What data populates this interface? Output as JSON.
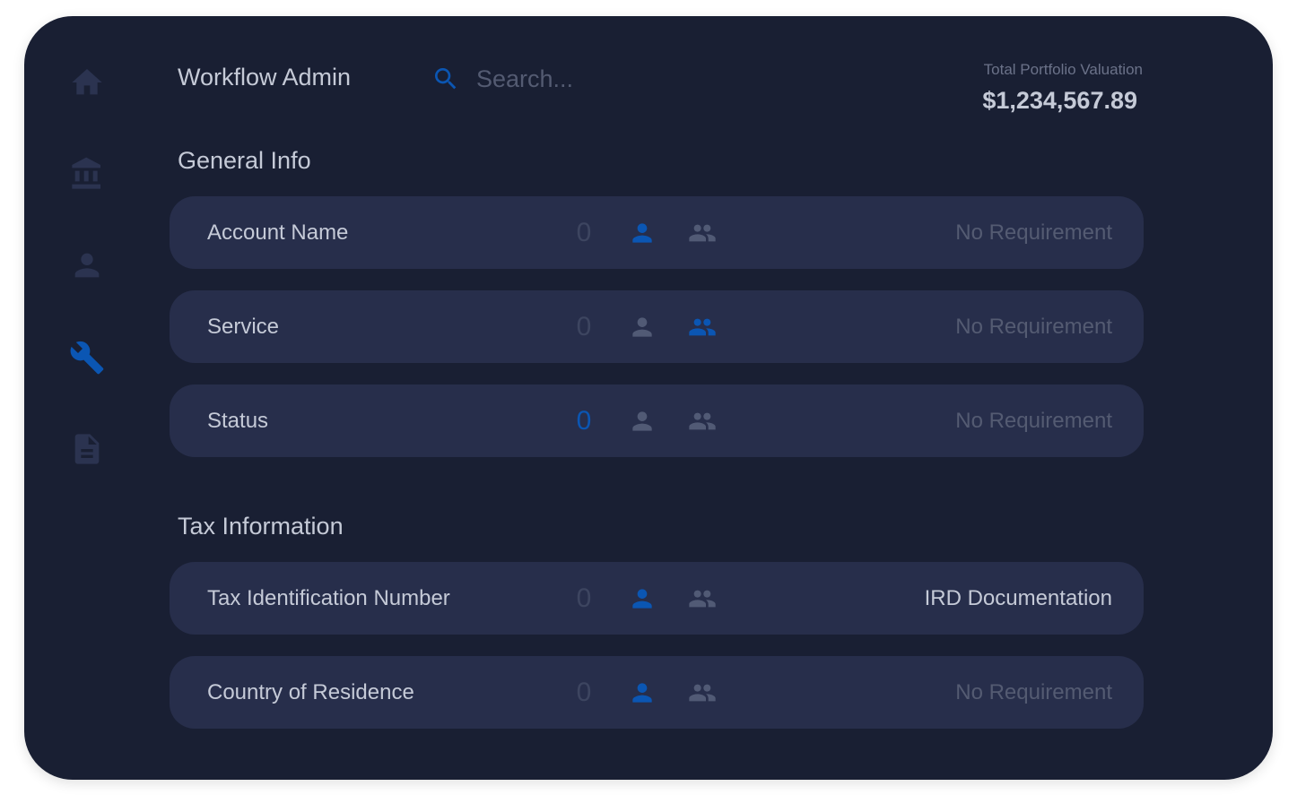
{
  "app": {
    "title": "Workflow Admin"
  },
  "search": {
    "placeholder": "Search..."
  },
  "portfolio": {
    "label": "Total Portfolio Valuation",
    "value": "$1,234,567.89"
  },
  "sidebar": {
    "items": [
      {
        "icon": "home-icon",
        "active": false
      },
      {
        "icon": "bank-icon",
        "active": false
      },
      {
        "icon": "person-icon",
        "active": false
      },
      {
        "icon": "wrench-icon",
        "active": true
      },
      {
        "icon": "document-icon",
        "active": false
      }
    ]
  },
  "sections": [
    {
      "title": "General Info",
      "rows": [
        {
          "label": "Account Name",
          "count": "0",
          "count_active": false,
          "individual_active": true,
          "group_active": false,
          "requirement": "No Requirement"
        },
        {
          "label": "Service",
          "count": "0",
          "count_active": false,
          "individual_active": false,
          "group_active": true,
          "requirement": "No Requirement"
        },
        {
          "label": "Status",
          "count": "0",
          "count_active": true,
          "individual_active": false,
          "group_active": false,
          "requirement": "No Requirement"
        }
      ]
    },
    {
      "title": "Tax Information",
      "rows": [
        {
          "label": "Tax Identification Number",
          "count": "0",
          "count_active": false,
          "individual_active": true,
          "group_active": false,
          "requirement": "IRD Documentation"
        },
        {
          "label": "Country of Residence",
          "count": "0",
          "count_active": false,
          "individual_active": true,
          "group_active": false,
          "requirement": "No Requirement"
        }
      ]
    }
  ],
  "colors": {
    "background": "#191f33",
    "card": "#272e4b",
    "accent": "#0b56b3",
    "text": "#c5cad7",
    "muted": "#545b72"
  }
}
